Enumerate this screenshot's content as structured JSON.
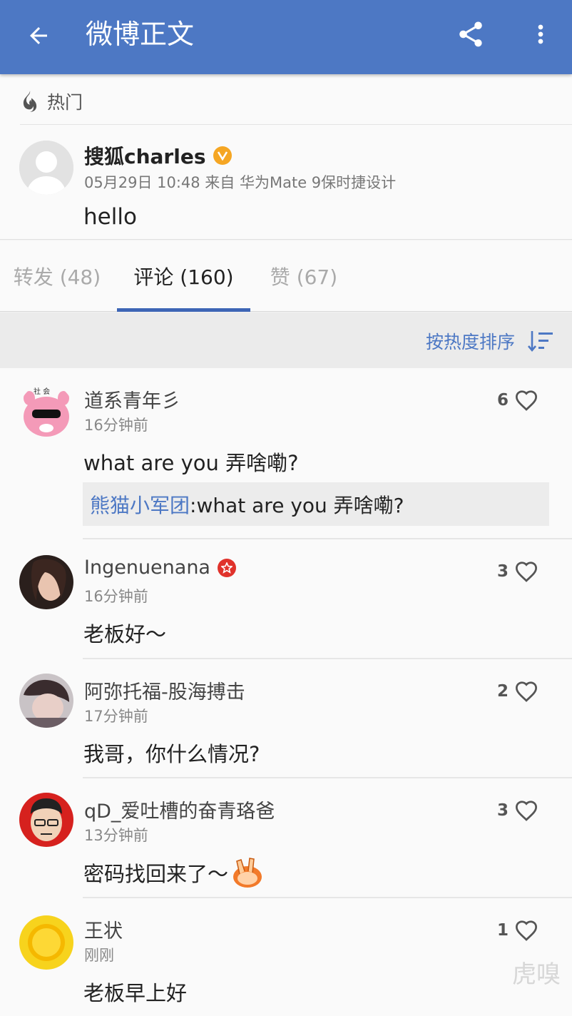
{
  "appbar": {
    "title": "微博正文",
    "back_icon": "arrow-back-icon",
    "share_icon": "share-icon",
    "more_icon": "more-vert-icon",
    "color": "#4d78c4"
  },
  "post": {
    "hot_label": "热门",
    "author": "搜狐charles",
    "meta": "05月29日 10:48 来自 华为Mate 9保时捷设计",
    "body": "hello"
  },
  "tabs": [
    {
      "label": "转发 (48)"
    },
    {
      "label": "评论 (160)",
      "active": true
    },
    {
      "label": "赞 (67)"
    }
  ],
  "sort": {
    "label": "按热度排序"
  },
  "comments": [
    {
      "name": "道系青年彡",
      "time": "16分钟前",
      "text": "what are you 弄啥嘞?",
      "likes": "6",
      "quote": {
        "name": "熊猫小军团",
        "text": ":what are you 弄啥嘞?"
      }
    },
    {
      "name": "Ingenuenana",
      "time": "16分钟前",
      "text": "老板好～",
      "likes": "3"
    },
    {
      "name": "阿弥托福-股海搏击",
      "time": "17分钟前",
      "text": "我哥，你什么情况?",
      "likes": "2"
    },
    {
      "name": "qD_爱吐槽的奋青珞爸",
      "time": "13分钟前",
      "text": "密码找回来了～",
      "likes": "3"
    },
    {
      "name": "王状",
      "time": "刚刚",
      "text": "老板早上好",
      "likes": "1"
    }
  ],
  "watermark": "虎嗅"
}
